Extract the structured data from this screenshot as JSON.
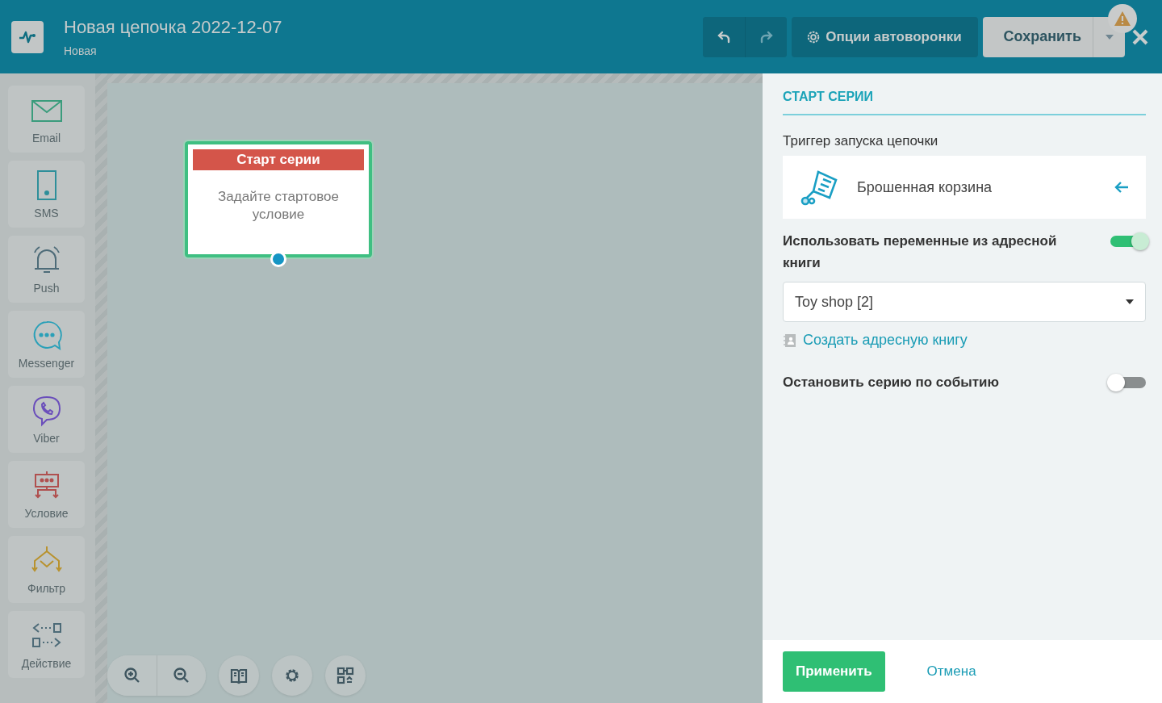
{
  "header": {
    "title": "Новая цепочка 2022-12-07",
    "subtitle": "Новая",
    "options_button": "Опции автоворонки",
    "save_button": "Сохранить",
    "undo_disabled": false,
    "redo_disabled": true,
    "warning": true
  },
  "palette": [
    {
      "kind": "email",
      "label": "Email",
      "color": "#3a9c7c"
    },
    {
      "kind": "sms",
      "label": "SMS",
      "color": "#2e8f9a"
    },
    {
      "kind": "push",
      "label": "Push",
      "color": "#4d6b78"
    },
    {
      "kind": "messenger",
      "label": "Messenger",
      "color": "#2aa0b8"
    },
    {
      "kind": "viber",
      "label": "Viber",
      "color": "#6b4fbb"
    },
    {
      "kind": "condition",
      "label": "Условие",
      "color": "#b0504f"
    },
    {
      "kind": "filter",
      "label": "Фильтр",
      "color": "#b8922e"
    },
    {
      "kind": "action",
      "label": "Действие",
      "color": "#4d6b78"
    }
  ],
  "canvas": {
    "node": {
      "title": "Старт серии",
      "text": "Задайте стартовое условие"
    }
  },
  "panel": {
    "heading": "СТАРТ СЕРИИ",
    "trigger_label": "Триггер запуска цепочки",
    "trigger_value": "Брошенная корзина",
    "address_toggle": {
      "label": "Использовать переменные из адресной книги",
      "on": true
    },
    "address_book": {
      "value": "Toy shop [2]"
    },
    "create_link": "Создать адресную книгу",
    "stop_toggle": {
      "label": "Остановить серию по событию",
      "on": false
    },
    "apply_button": "Применить",
    "cancel_button": "Отмена"
  }
}
